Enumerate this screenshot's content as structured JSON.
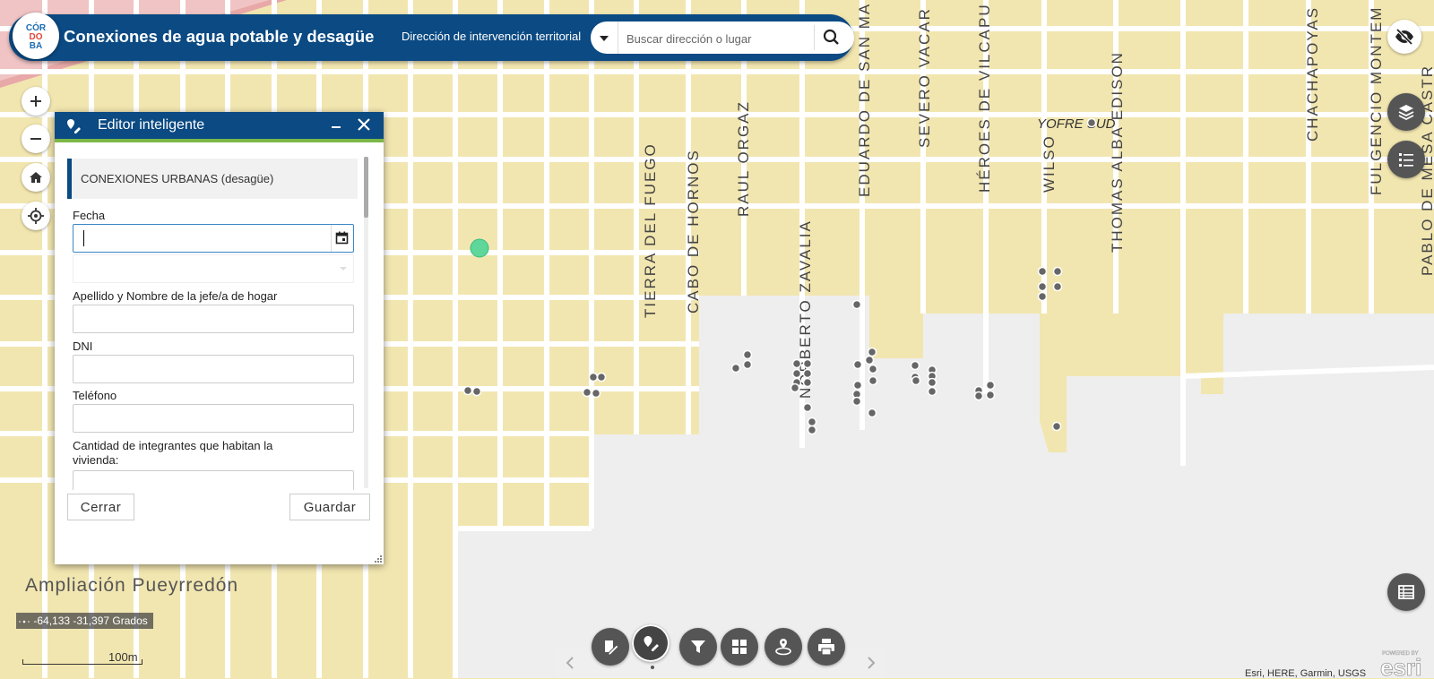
{
  "app": {
    "title": "Conexiones de agua potable y desagüe",
    "subtitle": "Dirección de intervención territorial",
    "logo_text": "CÓRDOBA"
  },
  "search": {
    "placeholder": "Buscar dirección o lugar"
  },
  "map": {
    "street_labels": [
      "TIERRA DEL FUEGO",
      "CABO DE HORNOS",
      "RAUL ORGAZ",
      "NORBERTO ZAVALIA",
      "EDUARDO DE SAN MA",
      "SEVERO VACAR",
      "HÉROES DE VILCAPU",
      "WILSO",
      "THOMAS ALBA EDISON",
      "CHACHAPOYAS",
      "FULGENCIO MONTEM",
      "PABLO DE MESA CASTR"
    ],
    "place_label": "YOFRE SUD",
    "area_label": "Ampliación Pueyrredón",
    "colors": {
      "land": "#f2e6b0",
      "streets": "#ffffff",
      "grey_area": "#eeeeee",
      "header": "#0b4a83",
      "accent": "#7ab648"
    }
  },
  "editor": {
    "title": "Editor inteligente",
    "layer": "CONEXIONES URBANAS (desagüe)",
    "fields": [
      {
        "label": "Fecha",
        "value": ""
      },
      {
        "label": "Apellido y Nombre de la jefe/a de hogar",
        "value": ""
      },
      {
        "label": "DNI",
        "value": ""
      },
      {
        "label": "Teléfono",
        "value": ""
      },
      {
        "label": "Cantidad de integrantes que habitan la vivienda:",
        "value": ""
      }
    ],
    "close_label": "Cerrar",
    "save_label": "Guardar"
  },
  "coords": {
    "text": "-64,133 -31,397 Grados"
  },
  "scale": {
    "label": "100m"
  },
  "attribution": "Esri, HERE, Garmin, USGS",
  "icons": {
    "zoom_in": "plus-icon",
    "zoom_out": "minus-icon",
    "home": "home-icon",
    "locate": "locate-icon",
    "visibility": "eye-off-icon",
    "layers": "layers-icon",
    "legend": "list-icon",
    "table": "table-icon",
    "tools": [
      "edit-feature-icon",
      "smart-editor-icon",
      "filter-icon",
      "grid-icon",
      "location-icon",
      "print-icon"
    ]
  }
}
